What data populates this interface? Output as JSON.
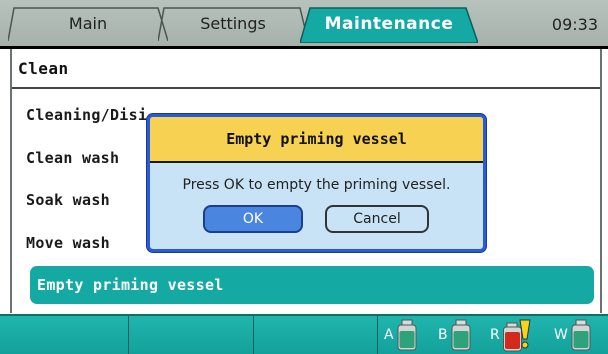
{
  "tabs": [
    {
      "label": "Main",
      "active": false
    },
    {
      "label": "Settings",
      "active": false
    },
    {
      "label": "Maintenance",
      "active": true
    }
  ],
  "clock": "09:33",
  "section": {
    "title": "Clean",
    "items": [
      {
        "label": "Cleaning/Disi"
      },
      {
        "label": "Clean wash"
      },
      {
        "label": "Soak wash"
      },
      {
        "label": "Move wash"
      }
    ],
    "selected_item": "Empty priming vessel"
  },
  "dialog": {
    "title": "Empty priming vessel",
    "message": "Press OK to empty the priming vessel.",
    "ok_label": "OK",
    "cancel_label": "Cancel"
  },
  "status": {
    "indicators": [
      {
        "letter": "A",
        "icon": "bottle-icon",
        "color": "#2ea37a",
        "warning": false
      },
      {
        "letter": "B",
        "icon": "bottle-icon",
        "color": "#2ea37a",
        "warning": false
      },
      {
        "letter": "R",
        "icon": "bottle-icon",
        "color": "#d42a1e",
        "warning": true
      },
      {
        "letter": "W",
        "icon": "bottle-icon",
        "color": "#2ea37a",
        "warning": false
      }
    ]
  },
  "colors": {
    "accent": "#14a9a2",
    "dialog_header": "#f7d152",
    "dialog_body": "#c8e3f6",
    "ok_button": "#4a86e0"
  }
}
